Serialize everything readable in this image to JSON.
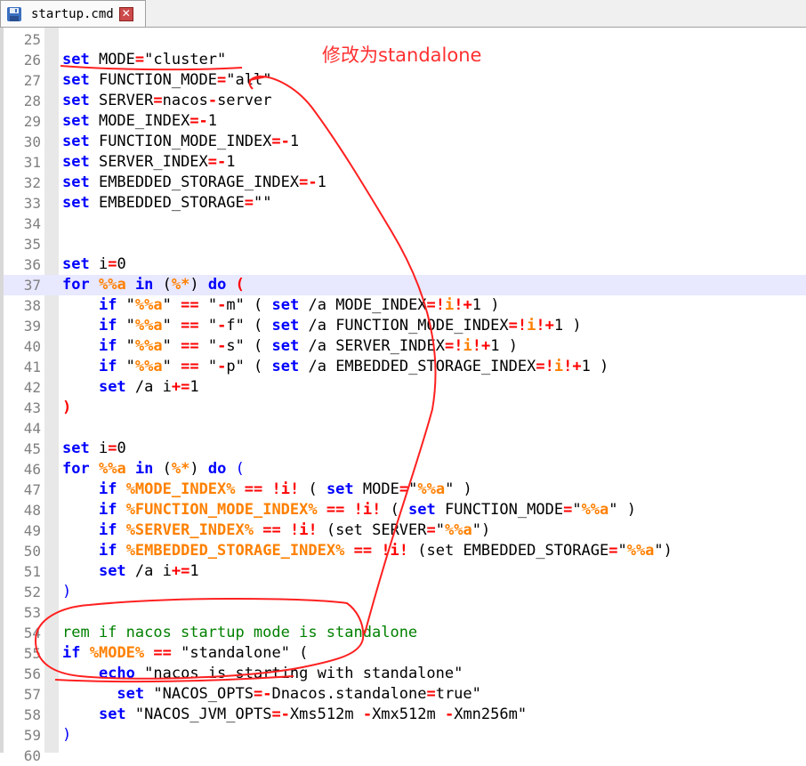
{
  "tab": {
    "filename": "startup.cmd",
    "close_glyph": "✕"
  },
  "annotation": "修改为standalone",
  "current_line": 37,
  "lines": [
    {
      "n": "25",
      "tokens": []
    },
    {
      "n": "26",
      "tokens": [
        [
          "kw",
          "set"
        ],
        [
          "t",
          " MODE"
        ],
        [
          "op",
          "="
        ],
        [
          "t",
          "\"cluster\""
        ]
      ]
    },
    {
      "n": "27",
      "tokens": [
        [
          "kw",
          "set"
        ],
        [
          "t",
          " FUNCTION_MODE"
        ],
        [
          "op",
          "="
        ],
        [
          "t",
          "\"all\""
        ]
      ]
    },
    {
      "n": "28",
      "tokens": [
        [
          "kw",
          "set"
        ],
        [
          "t",
          " SERVER"
        ],
        [
          "op",
          "="
        ],
        [
          "t",
          "nacos"
        ],
        [
          "op",
          "-"
        ],
        [
          "t",
          "server"
        ]
      ]
    },
    {
      "n": "29",
      "tokens": [
        [
          "kw",
          "set"
        ],
        [
          "t",
          " MODE_INDEX"
        ],
        [
          "op",
          "=-"
        ],
        [
          "t",
          "1"
        ]
      ]
    },
    {
      "n": "30",
      "tokens": [
        [
          "kw",
          "set"
        ],
        [
          "t",
          " FUNCTION_MODE_INDEX"
        ],
        [
          "op",
          "=-"
        ],
        [
          "t",
          "1"
        ]
      ]
    },
    {
      "n": "31",
      "tokens": [
        [
          "kw",
          "set"
        ],
        [
          "t",
          " SERVER_INDEX"
        ],
        [
          "op",
          "=-"
        ],
        [
          "t",
          "1"
        ]
      ]
    },
    {
      "n": "32",
      "tokens": [
        [
          "kw",
          "set"
        ],
        [
          "t",
          " EMBEDDED_STORAGE_INDEX"
        ],
        [
          "op",
          "=-"
        ],
        [
          "t",
          "1"
        ]
      ]
    },
    {
      "n": "33",
      "tokens": [
        [
          "kw",
          "set"
        ],
        [
          "t",
          " EMBEDDED_STORAGE"
        ],
        [
          "op",
          "="
        ],
        [
          "t",
          "\"\""
        ]
      ]
    },
    {
      "n": "34",
      "tokens": []
    },
    {
      "n": "35",
      "tokens": []
    },
    {
      "n": "36",
      "tokens": [
        [
          "kw",
          "set"
        ],
        [
          "t",
          " i"
        ],
        [
          "op",
          "="
        ],
        [
          "t",
          "0"
        ]
      ]
    },
    {
      "n": "37",
      "tokens": [
        [
          "kw",
          "for"
        ],
        [
          "t",
          " "
        ],
        [
          "var",
          "%%a"
        ],
        [
          "t",
          " "
        ],
        [
          "kw",
          "in"
        ],
        [
          "t",
          " ("
        ],
        [
          "var",
          "%*"
        ],
        [
          "t",
          ") "
        ],
        [
          "kw",
          "do"
        ],
        [
          "t",
          " "
        ],
        [
          "pr",
          "("
        ]
      ]
    },
    {
      "n": "38",
      "tokens": [
        [
          "t",
          "    "
        ],
        [
          "kw",
          "if"
        ],
        [
          "t",
          " \""
        ],
        [
          "var",
          "%%a"
        ],
        [
          "t",
          "\" "
        ],
        [
          "op",
          "=="
        ],
        [
          "t",
          " \""
        ],
        [
          "op",
          "-"
        ],
        [
          "t",
          "m\" ( "
        ],
        [
          "kw",
          "set"
        ],
        [
          "t",
          " /a MODE_INDEX"
        ],
        [
          "op",
          "=!"
        ],
        [
          "var",
          "i"
        ],
        [
          "op",
          "!+"
        ],
        [
          "t",
          "1 )"
        ]
      ]
    },
    {
      "n": "39",
      "tokens": [
        [
          "t",
          "    "
        ],
        [
          "kw",
          "if"
        ],
        [
          "t",
          " \""
        ],
        [
          "var",
          "%%a"
        ],
        [
          "t",
          "\" "
        ],
        [
          "op",
          "=="
        ],
        [
          "t",
          " \""
        ],
        [
          "op",
          "-"
        ],
        [
          "t",
          "f\" ( "
        ],
        [
          "kw",
          "set"
        ],
        [
          "t",
          " /a FUNCTION_MODE_INDEX"
        ],
        [
          "op",
          "=!"
        ],
        [
          "var",
          "i"
        ],
        [
          "op",
          "!+"
        ],
        [
          "t",
          "1 )"
        ]
      ]
    },
    {
      "n": "40",
      "tokens": [
        [
          "t",
          "    "
        ],
        [
          "kw",
          "if"
        ],
        [
          "t",
          " \""
        ],
        [
          "var",
          "%%a"
        ],
        [
          "t",
          "\" "
        ],
        [
          "op",
          "=="
        ],
        [
          "t",
          " \""
        ],
        [
          "op",
          "-"
        ],
        [
          "t",
          "s\" ( "
        ],
        [
          "kw",
          "set"
        ],
        [
          "t",
          " /a SERVER_INDEX"
        ],
        [
          "op",
          "=!"
        ],
        [
          "var",
          "i"
        ],
        [
          "op",
          "!+"
        ],
        [
          "t",
          "1 )"
        ]
      ]
    },
    {
      "n": "41",
      "tokens": [
        [
          "t",
          "    "
        ],
        [
          "kw",
          "if"
        ],
        [
          "t",
          " \""
        ],
        [
          "var",
          "%%a"
        ],
        [
          "t",
          "\" "
        ],
        [
          "op",
          "=="
        ],
        [
          "t",
          " \""
        ],
        [
          "op",
          "-"
        ],
        [
          "t",
          "p\" ( "
        ],
        [
          "kw",
          "set"
        ],
        [
          "t",
          " /a EMBEDDED_STORAGE_INDEX"
        ],
        [
          "op",
          "=!"
        ],
        [
          "var",
          "i"
        ],
        [
          "op",
          "!+"
        ],
        [
          "t",
          "1 )"
        ]
      ]
    },
    {
      "n": "42",
      "tokens": [
        [
          "t",
          "    "
        ],
        [
          "kw",
          "set"
        ],
        [
          "t",
          " /a i"
        ],
        [
          "op",
          "+="
        ],
        [
          "t",
          "1"
        ]
      ]
    },
    {
      "n": "43",
      "tokens": [
        [
          "pr",
          ")"
        ]
      ]
    },
    {
      "n": "44",
      "tokens": []
    },
    {
      "n": "45",
      "tokens": [
        [
          "kw",
          "set"
        ],
        [
          "t",
          " i"
        ],
        [
          "op",
          "="
        ],
        [
          "t",
          "0"
        ]
      ]
    },
    {
      "n": "46",
      "tokens": [
        [
          "kw",
          "for"
        ],
        [
          "t",
          " "
        ],
        [
          "var",
          "%%a"
        ],
        [
          "t",
          " "
        ],
        [
          "kw",
          "in"
        ],
        [
          "t",
          " ("
        ],
        [
          "var",
          "%*"
        ],
        [
          "t",
          ") "
        ],
        [
          "kw",
          "do"
        ],
        [
          "t",
          " "
        ],
        [
          "pb",
          "("
        ]
      ]
    },
    {
      "n": "47",
      "tokens": [
        [
          "t",
          "    "
        ],
        [
          "kw",
          "if"
        ],
        [
          "t",
          " "
        ],
        [
          "var",
          "%MODE_INDEX%"
        ],
        [
          "t",
          " "
        ],
        [
          "op",
          "=="
        ],
        [
          "t",
          " "
        ],
        [
          "op",
          "!i!"
        ],
        [
          "t",
          " ( "
        ],
        [
          "kw",
          "set"
        ],
        [
          "t",
          " MODE"
        ],
        [
          "op",
          "="
        ],
        [
          "t",
          "\""
        ],
        [
          "var",
          "%%a"
        ],
        [
          "t",
          "\" )"
        ]
      ]
    },
    {
      "n": "48",
      "tokens": [
        [
          "t",
          "    "
        ],
        [
          "kw",
          "if"
        ],
        [
          "t",
          " "
        ],
        [
          "var",
          "%FUNCTION_MODE_INDEX%"
        ],
        [
          "t",
          " "
        ],
        [
          "op",
          "=="
        ],
        [
          "t",
          " "
        ],
        [
          "op",
          "!i!"
        ],
        [
          "t",
          " ( "
        ],
        [
          "kw",
          "set"
        ],
        [
          "t",
          " FUNCTION_MODE"
        ],
        [
          "op",
          "="
        ],
        [
          "t",
          "\""
        ],
        [
          "var",
          "%%a"
        ],
        [
          "t",
          "\" )"
        ]
      ]
    },
    {
      "n": "49",
      "tokens": [
        [
          "t",
          "    "
        ],
        [
          "kw",
          "if"
        ],
        [
          "t",
          " "
        ],
        [
          "var",
          "%SERVER_INDEX%"
        ],
        [
          "t",
          " "
        ],
        [
          "op",
          "=="
        ],
        [
          "t",
          " "
        ],
        [
          "op",
          "!i!"
        ],
        [
          "t",
          " (set SERVER"
        ],
        [
          "op",
          "="
        ],
        [
          "t",
          "\""
        ],
        [
          "var",
          "%%a"
        ],
        [
          "t",
          "\")"
        ]
      ]
    },
    {
      "n": "50",
      "tokens": [
        [
          "t",
          "    "
        ],
        [
          "kw",
          "if"
        ],
        [
          "t",
          " "
        ],
        [
          "var",
          "%EMBEDDED_STORAGE_INDEX%"
        ],
        [
          "t",
          " "
        ],
        [
          "op",
          "=="
        ],
        [
          "t",
          " "
        ],
        [
          "op",
          "!i!"
        ],
        [
          "t",
          " (set EMBEDDED_STORAGE"
        ],
        [
          "op",
          "="
        ],
        [
          "t",
          "\""
        ],
        [
          "var",
          "%%a"
        ],
        [
          "t",
          "\")"
        ]
      ]
    },
    {
      "n": "51",
      "tokens": [
        [
          "t",
          "    "
        ],
        [
          "kw",
          "set"
        ],
        [
          "t",
          " /a i"
        ],
        [
          "op",
          "+="
        ],
        [
          "t",
          "1"
        ]
      ]
    },
    {
      "n": "52",
      "tokens": [
        [
          "pb",
          ")"
        ]
      ]
    },
    {
      "n": "53",
      "tokens": []
    },
    {
      "n": "54",
      "tokens": [
        [
          "cm",
          "rem if nacos startup mode is standalone"
        ]
      ]
    },
    {
      "n": "55",
      "tokens": [
        [
          "kw",
          "if"
        ],
        [
          "t",
          " "
        ],
        [
          "var",
          "%MODE%"
        ],
        [
          "t",
          " "
        ],
        [
          "op",
          "=="
        ],
        [
          "t",
          " \"standalone\" ("
        ]
      ]
    },
    {
      "n": "56",
      "tokens": [
        [
          "t",
          "    "
        ],
        [
          "kw",
          "echo"
        ],
        [
          "t",
          " \"nacos is starting with standalone\""
        ]
      ]
    },
    {
      "n": "57",
      "tokens": [
        [
          "t",
          "      "
        ],
        [
          "kw",
          "set"
        ],
        [
          "t",
          " \"NACOS_OPTS"
        ],
        [
          "op",
          "=-"
        ],
        [
          "t",
          "Dnacos.standalone"
        ],
        [
          "op",
          "="
        ],
        [
          "t",
          "true\""
        ]
      ]
    },
    {
      "n": "58",
      "tokens": [
        [
          "t",
          "    "
        ],
        [
          "kw",
          "set"
        ],
        [
          "t",
          " \"NACOS_JVM_OPTS"
        ],
        [
          "op",
          "=-"
        ],
        [
          "t",
          "Xms512m "
        ],
        [
          "op",
          "-"
        ],
        [
          "t",
          "Xmx512m "
        ],
        [
          "op",
          "-"
        ],
        [
          "t",
          "Xmn256m\""
        ]
      ]
    },
    {
      "n": "59",
      "tokens": [
        [
          "pb",
          ")"
        ]
      ]
    },
    {
      "n": "60",
      "tokens": []
    }
  ],
  "colors": {
    "keyword": "#0000ff",
    "operator": "#ff0000",
    "variable": "#ff8000",
    "comment": "#008000",
    "annotation": "#ff3030",
    "current_line": "#e8e8ff"
  }
}
